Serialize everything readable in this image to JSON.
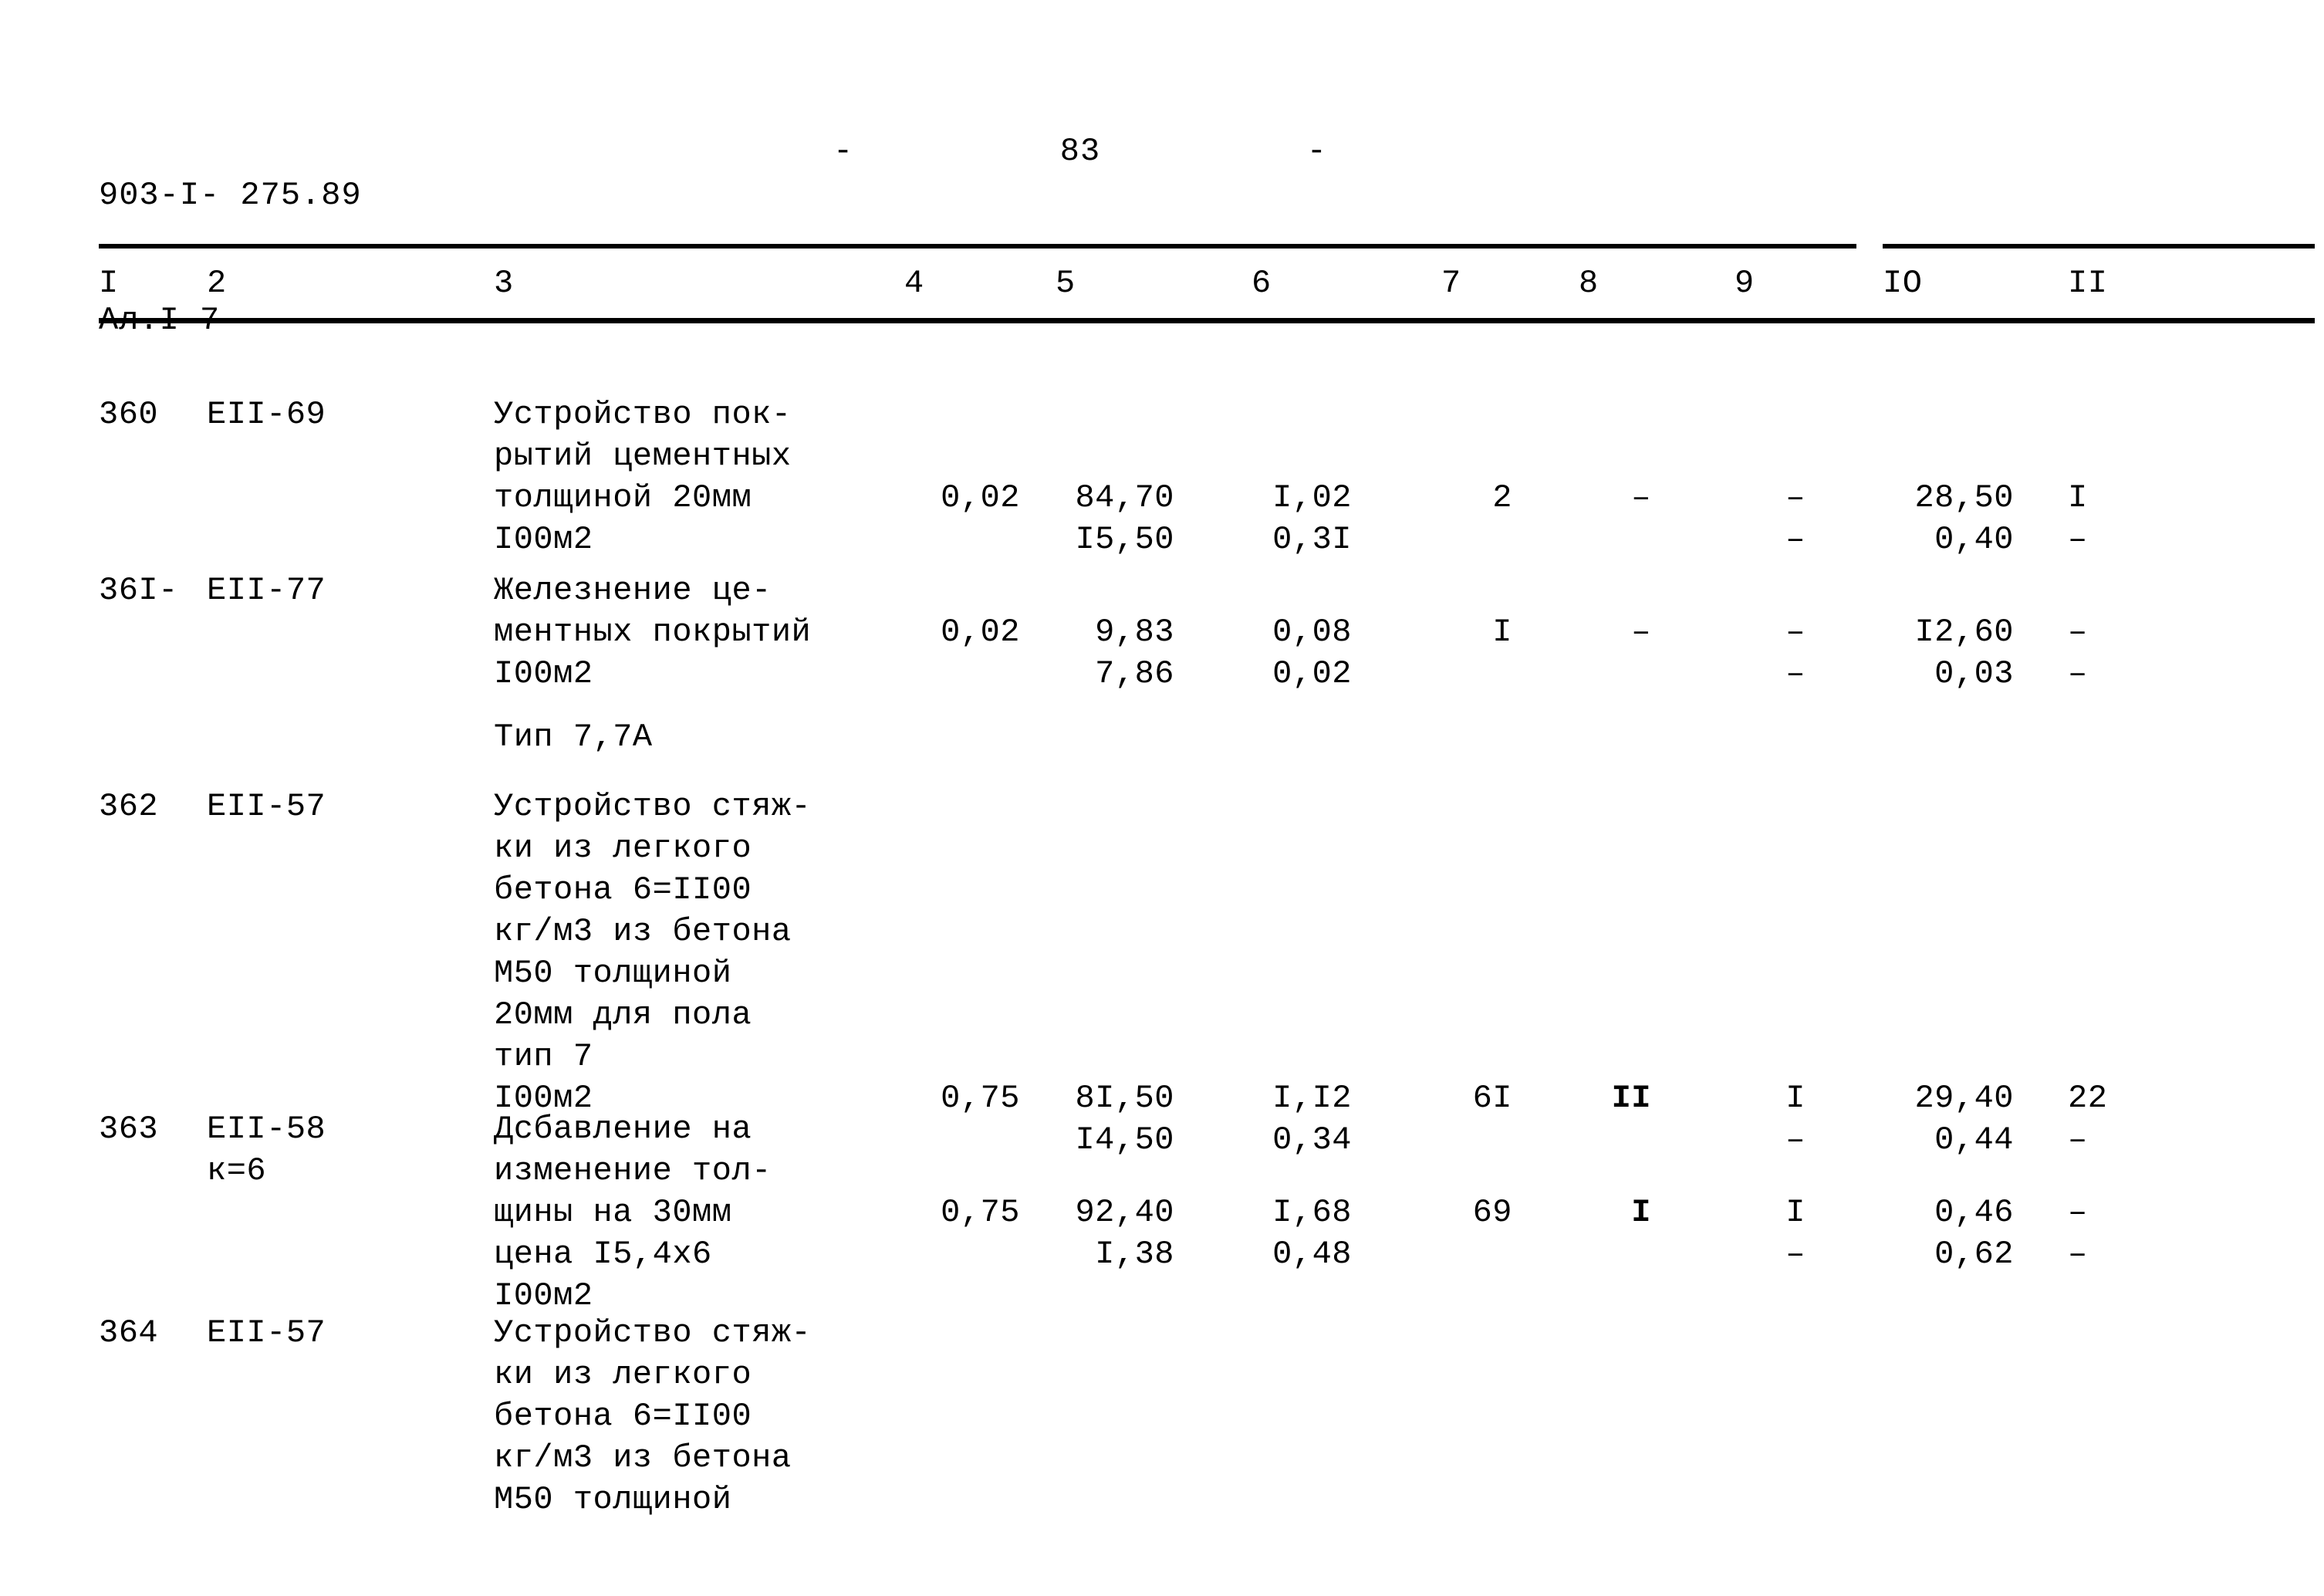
{
  "header": {
    "doc_code_line1": "903-I- 275.89",
    "doc_code_line2": "Ал.I 7",
    "dash_left": "-",
    "page_number": "83",
    "dash_right": "-"
  },
  "table": {
    "column_headers": [
      "I",
      "2",
      "3",
      "4",
      "5",
      "6",
      "7",
      "8",
      "9",
      "IO",
      "II"
    ],
    "rows": [
      {
        "num": "360",
        "code": "ЕII-69",
        "description": "Устройство пок-\nрытий цементных\nтолщиной 20мм\nI00м2",
        "c4": "0,02",
        "c5_top": "84,70",
        "c5_bot": "I5,50",
        "c6_top": "I,02",
        "c6_bot": "0,3I",
        "c7_top": "2",
        "c7_bot": "",
        "c8_top": "–",
        "c8_bot": "",
        "c9_top": "–",
        "c9_bot": "–",
        "c10_top": "28,50",
        "c10_bot": "0,40",
        "c11_top": "I",
        "c11_bot": "–"
      },
      {
        "num": "36I-",
        "code": "ЕII-77",
        "description": "Железнение це-\nментных покрытий\nI00м2",
        "c4": "0,02",
        "c5_top": "9,83",
        "c5_bot": "7,86",
        "c6_top": "0,08",
        "c6_bot": "0,02",
        "c7_top": "I",
        "c7_bot": "",
        "c8_top": "–",
        "c8_bot": "",
        "c9_top": "–",
        "c9_bot": "–",
        "c10_top": "I2,60",
        "c10_bot": "0,03",
        "c11_top": "–",
        "c11_bot": "–"
      },
      {
        "num": "362",
        "code": "ЕII-57",
        "description": "Устройство стяж-\nки из легкого\nбетона 6=II00\nкг/м3 из бетона\nМ50 толщиной\n20мм для пола\nтип 7\nI00м2",
        "c4": "0,75",
        "c5_top": "8I,50",
        "c5_bot": "I4,50",
        "c6_top": "I,I2",
        "c6_bot": "0,34",
        "c7_top": "6I",
        "c7_bot": "",
        "c8_top": "II",
        "c8_bot": "",
        "c9_top": "I",
        "c9_bot": "–",
        "c10_top": "29,40",
        "c10_bot": "0,44",
        "c11_top": "22",
        "c11_bot": "–"
      },
      {
        "num": "363",
        "code": "ЕII-58\nк=6",
        "description": "Дсбавление на\nизменение тол-\nщины на 30мм\nцена I5,4х6\nI00м2",
        "c4": "0,75",
        "c5_top": "92,40",
        "c5_bot": "I,38",
        "c6_top": "I,68",
        "c6_bot": "0,48",
        "c7_top": "69",
        "c7_bot": "",
        "c8_top": "I",
        "c8_bot": "",
        "c9_top": "I",
        "c9_bot": "–",
        "c10_top": "0,46",
        "c10_bot": "0,62",
        "c11_top": "–",
        "c11_bot": "–"
      },
      {
        "num": "364",
        "code": "ЕII-57",
        "description": "Устройство стяж-\nки из легкого\nбетона 6=II00\nкг/м3 из бетона\nМ50 толщиной",
        "c4": "",
        "c5_top": "",
        "c5_bot": "",
        "c6_top": "",
        "c6_bot": "",
        "c7_top": "",
        "c7_bot": "",
        "c8_top": "",
        "c8_bot": "",
        "c9_top": "",
        "c9_bot": "",
        "c10_top": "",
        "c10_bot": "",
        "c11_top": "",
        "c11_bot": ""
      }
    ],
    "subheading_type": "Тип 7,7А"
  }
}
